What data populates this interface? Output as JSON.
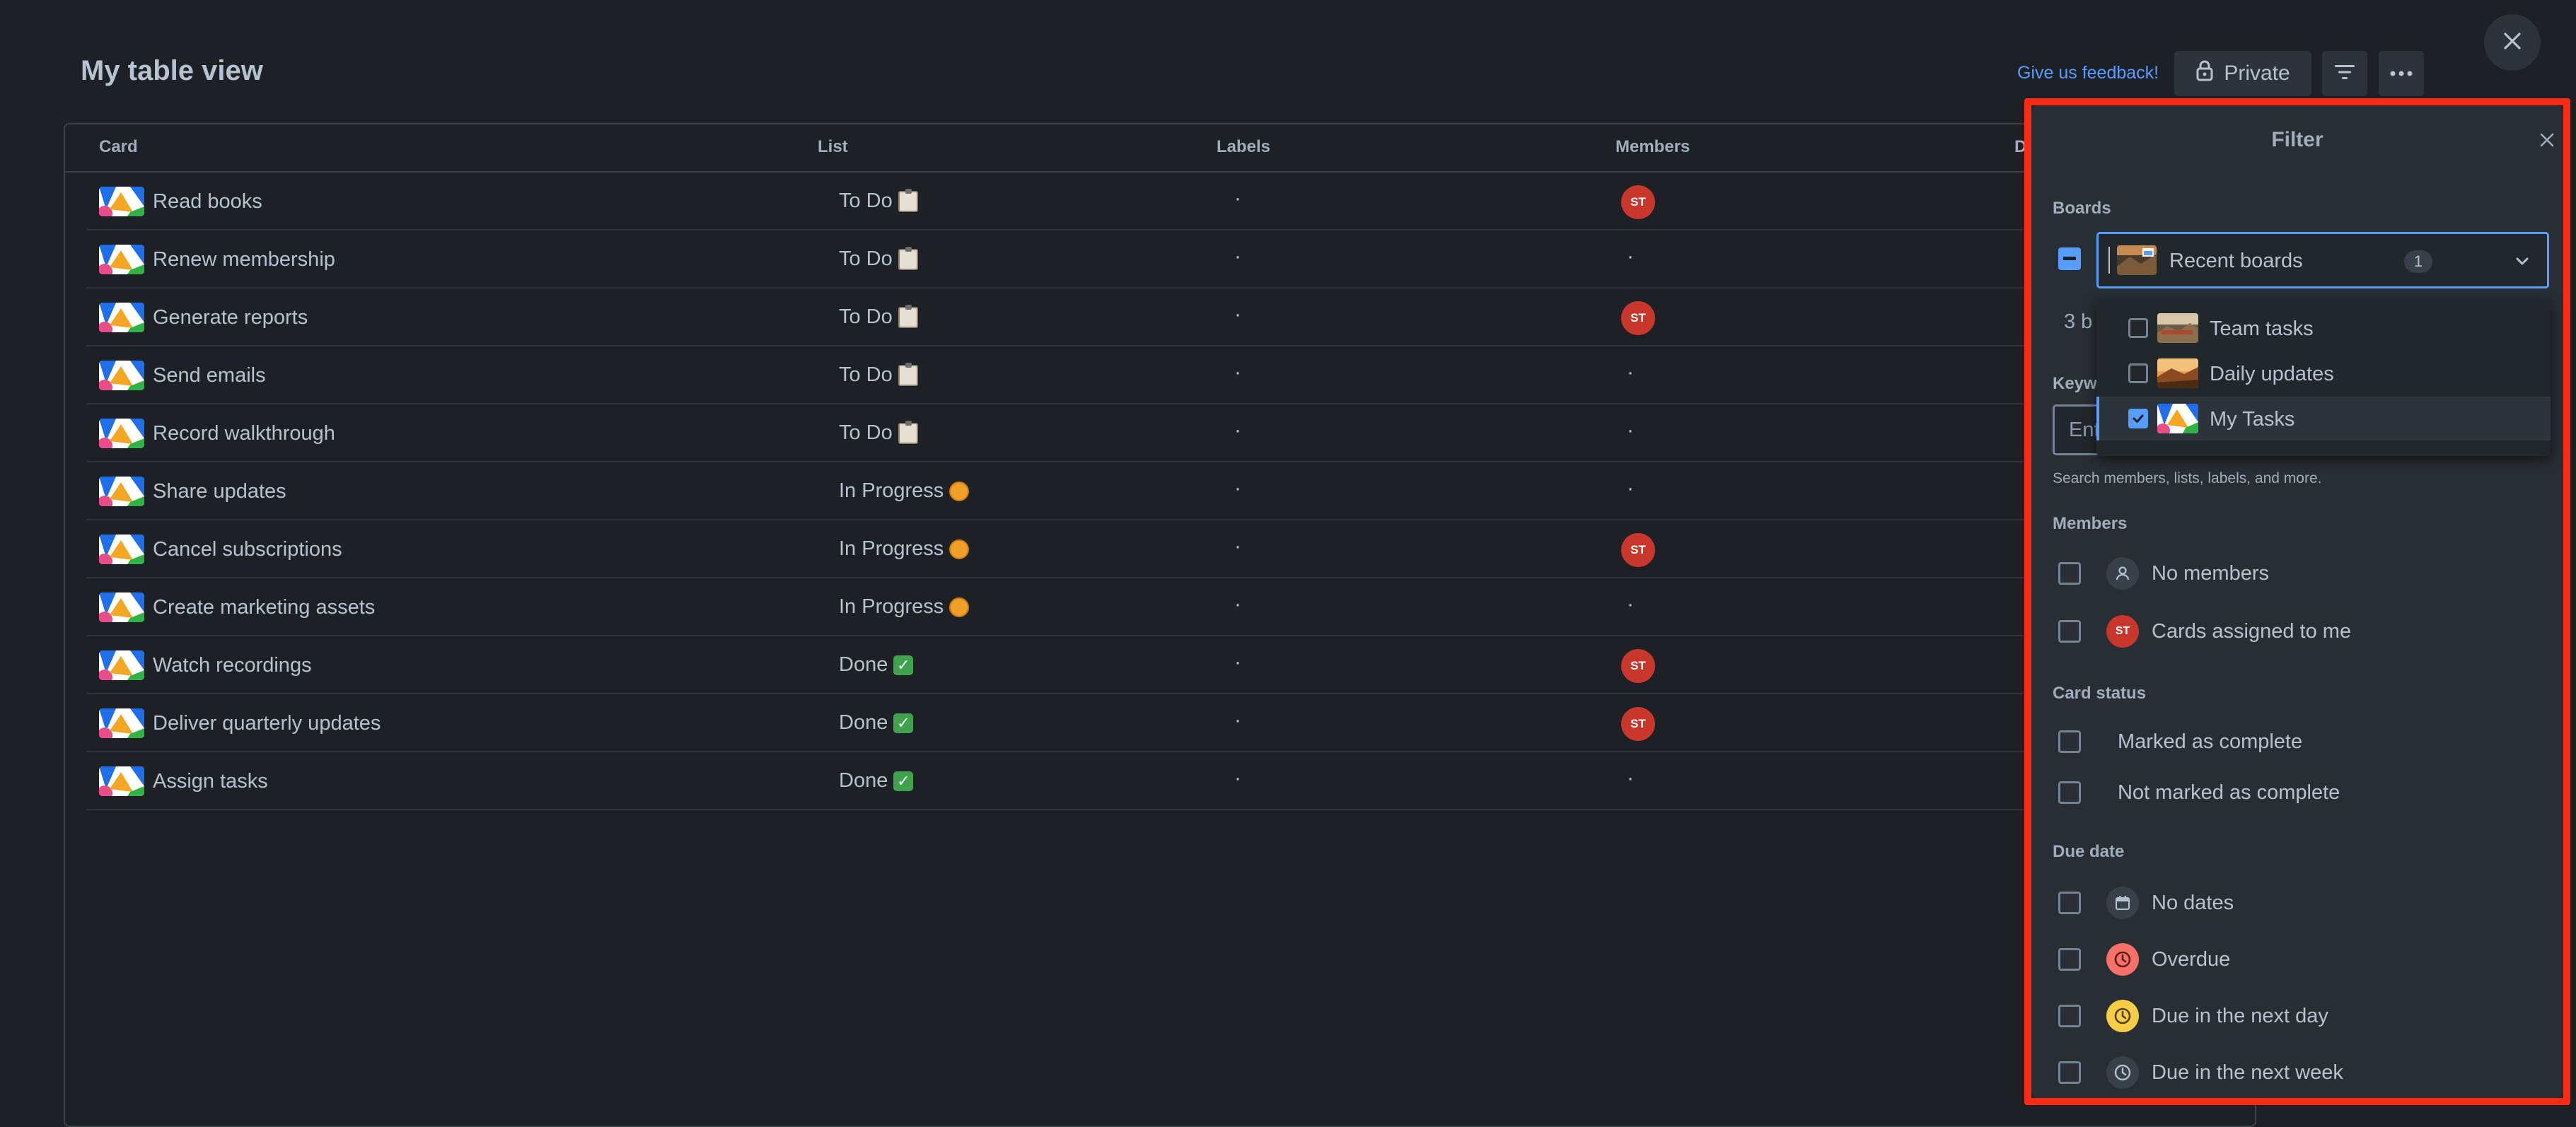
{
  "page": {
    "title": "My table view"
  },
  "header": {
    "feedback_link": "Give us feedback!",
    "private_label": "Private",
    "icons": [
      "lock-icon",
      "filter-icon",
      "more-icon",
      "close-icon"
    ]
  },
  "table": {
    "columns": [
      "Card",
      "List",
      "Labels",
      "Members",
      "D"
    ],
    "rows": [
      {
        "card": "Read books",
        "list": "To Do",
        "list_emoji": "clipboard",
        "labels": "·",
        "member": "ST"
      },
      {
        "card": "Renew membership",
        "list": "To Do",
        "list_emoji": "clipboard",
        "labels": "·",
        "member": "·"
      },
      {
        "card": "Generate reports",
        "list": "To Do",
        "list_emoji": "clipboard",
        "labels": "·",
        "member": "ST"
      },
      {
        "card": "Send emails",
        "list": "To Do",
        "list_emoji": "clipboard",
        "labels": "·",
        "member": "·"
      },
      {
        "card": "Record walkthrough",
        "list": "To Do",
        "list_emoji": "clipboard",
        "labels": "·",
        "member": "·"
      },
      {
        "card": "Share updates",
        "list": "In Progress",
        "list_emoji": "orange-circle",
        "labels": "·",
        "member": "·"
      },
      {
        "card": "Cancel subscriptions",
        "list": "In Progress",
        "list_emoji": "orange-circle",
        "labels": "·",
        "member": "ST"
      },
      {
        "card": "Create marketing assets",
        "list": "In Progress",
        "list_emoji": "orange-circle",
        "labels": "·",
        "member": "·"
      },
      {
        "card": "Watch recordings",
        "list": "Done",
        "list_emoji": "check-mark",
        "labels": "·",
        "member": "ST"
      },
      {
        "card": "Deliver quarterly updates",
        "list": "Done",
        "list_emoji": "check-mark",
        "labels": "·",
        "member": "ST"
      },
      {
        "card": "Assign tasks",
        "list": "Done",
        "list_emoji": "check-mark",
        "labels": "·",
        "member": "·"
      }
    ]
  },
  "filter": {
    "title": "Filter",
    "boards_label": "Boards",
    "board_select": {
      "value": "Recent boards",
      "count": "1"
    },
    "boards_summary_partial": "3 b",
    "keyword_label_partial": "Keyw",
    "keyword_placeholder": "Ent",
    "keyword_hint": "Search members, lists, labels, and more.",
    "dropdown": [
      {
        "label": "Team tasks",
        "checked": false
      },
      {
        "label": "Daily updates",
        "checked": false
      },
      {
        "label": "My Tasks",
        "checked": true
      }
    ],
    "members_label": "Members",
    "members": [
      {
        "label": "No members",
        "icon": "person-icon"
      },
      {
        "label": "Cards assigned to me",
        "avatar": "ST"
      }
    ],
    "card_status_label": "Card status",
    "card_status": [
      "Marked as complete",
      "Not marked as complete"
    ],
    "due_date_label": "Due date",
    "due_dates": [
      {
        "label": "No dates",
        "icon": "calendar-icon",
        "color": "#38414a"
      },
      {
        "label": "Overdue",
        "icon": "clock-icon",
        "color": "#f87168"
      },
      {
        "label": "Due in the next day",
        "icon": "clock-icon",
        "color": "#f5cd47"
      },
      {
        "label": "Due in the next week",
        "icon": "clock-icon",
        "color": "#38414a"
      }
    ]
  },
  "colors": {
    "background": "#1d2125",
    "panel": "#282e33",
    "accent": "#579dff",
    "avatar": "#c9372c",
    "highlight": "#ff2a12"
  }
}
